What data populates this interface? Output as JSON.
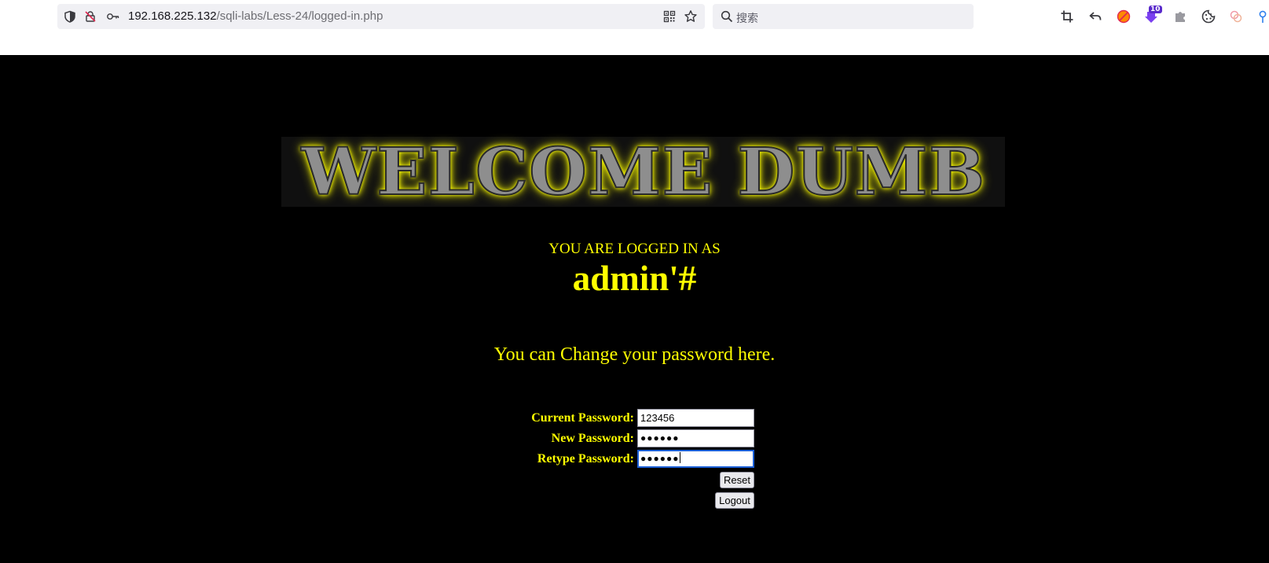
{
  "browser": {
    "url_host": "192.168.225.132",
    "url_path": "/sqli-labs/Less-24/logged-in.php",
    "search_placeholder": "搜索",
    "extension_badge": "10"
  },
  "page": {
    "banner_text": "WELCOME DUMB",
    "logged_in_label": "YOU ARE LOGGED IN AS",
    "username": "admin'#",
    "change_message": "You can Change your password here."
  },
  "form": {
    "current_password_label": "Current Password:",
    "current_password_value": "123456",
    "new_password_label": "New Password:",
    "new_password_mask": "●●●●●●",
    "retype_password_label": "Retype Password:",
    "retype_password_mask": "●●●●●●",
    "reset_label": "Reset",
    "logout_label": "Logout"
  },
  "colors": {
    "page_background": "#000000",
    "text_accent": "#ffff00",
    "focus_ring": "#1b5fd6"
  }
}
